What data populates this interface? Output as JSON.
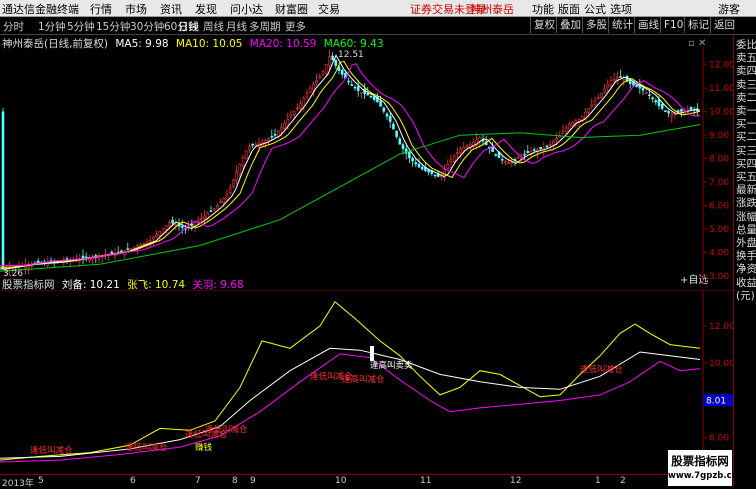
{
  "menu": {
    "logo": "通达信金融终端",
    "items": [
      "行情",
      "市场",
      "资讯",
      "发现",
      "问小达",
      "财富圈",
      "交易"
    ],
    "notice": "证券交易未登录",
    "stock": "神州泰岳",
    "right_items": [
      "功能",
      "版面",
      "公式",
      "选项"
    ],
    "user": "游客"
  },
  "toolbar": {
    "periods": [
      "分时",
      "1分钟",
      "5分钟",
      "15分钟",
      "30分钟",
      "60分钟",
      "日线",
      "周线",
      "月线",
      "多周期",
      "更多"
    ],
    "active": "日线",
    "right_buttons": [
      "复权",
      "叠加",
      "多股",
      "统计",
      "画线",
      "F10",
      "标记",
      "+自选",
      "返回"
    ]
  },
  "main_chart": {
    "title": "神州泰岳(日线,前复权)",
    "ma": [
      {
        "label": "MA5: 9.98",
        "color": "#ffffff"
      },
      {
        "label": "MA10: 10.05",
        "color": "#ffff00"
      },
      {
        "label": "MA20: 10.59",
        "color": "#ff00ff"
      },
      {
        "label": "MA60: 9.43",
        "color": "#00ff00"
      }
    ],
    "high_label": "12.51",
    "low_label": "3.26",
    "y_ticks": [
      "12.00",
      "11.00",
      "10.00",
      "9.00",
      "8.00",
      "7.00",
      "6.00",
      "5.00",
      "4.00",
      "3.00"
    ]
  },
  "indicator": {
    "name": "股票指标网",
    "lines": [
      {
        "label": "刘备: 10.21",
        "color": "#ffffff"
      },
      {
        "label": "张飞: 10.74",
        "color": "#ffff00"
      },
      {
        "label": "关羽: 9.68",
        "color": "#ff00ff"
      }
    ],
    "y_ticks": [
      "12.00",
      "10.00",
      "8.00",
      "6.00"
    ],
    "value_box": "8.01",
    "annotations": [
      {
        "text": "逢低叫减仓",
        "color": "#ff3030"
      },
      {
        "text": "逢低叫减仓",
        "color": "#ff3030"
      },
      {
        "text": "逢低叫减仓",
        "color": "#ff3030"
      },
      {
        "text": "逢低叫减仓",
        "color": "#ff3030"
      },
      {
        "text": "逢低叫减仓",
        "color": "#ff3030"
      },
      {
        "text": "逢高叫减仓",
        "color": "#ff3030"
      },
      {
        "text": "逢高叫卖卖",
        "color": "#ffffff"
      },
      {
        "text": "逢低叫减仓",
        "color": "#ff3030"
      },
      {
        "text": "赚钱",
        "color": "#ffff00"
      }
    ]
  },
  "x_axis": [
    "2013年",
    "5",
    "6",
    "7",
    "8",
    "9",
    "10",
    "11",
    "12",
    "1",
    "2"
  ],
  "right_panel": [
    "委比",
    "卖五",
    "卖四",
    "卖三",
    "卖二",
    "卖一",
    "买一",
    "买二",
    "买三",
    "买四",
    "买五",
    "最新",
    "涨跌",
    "涨幅",
    "总量",
    "外盘",
    "换手",
    "净资",
    "收益",
    "(元)"
  ],
  "watermark": {
    "line1": "股票指标网",
    "line2": "www.7gpzb.com"
  }
}
